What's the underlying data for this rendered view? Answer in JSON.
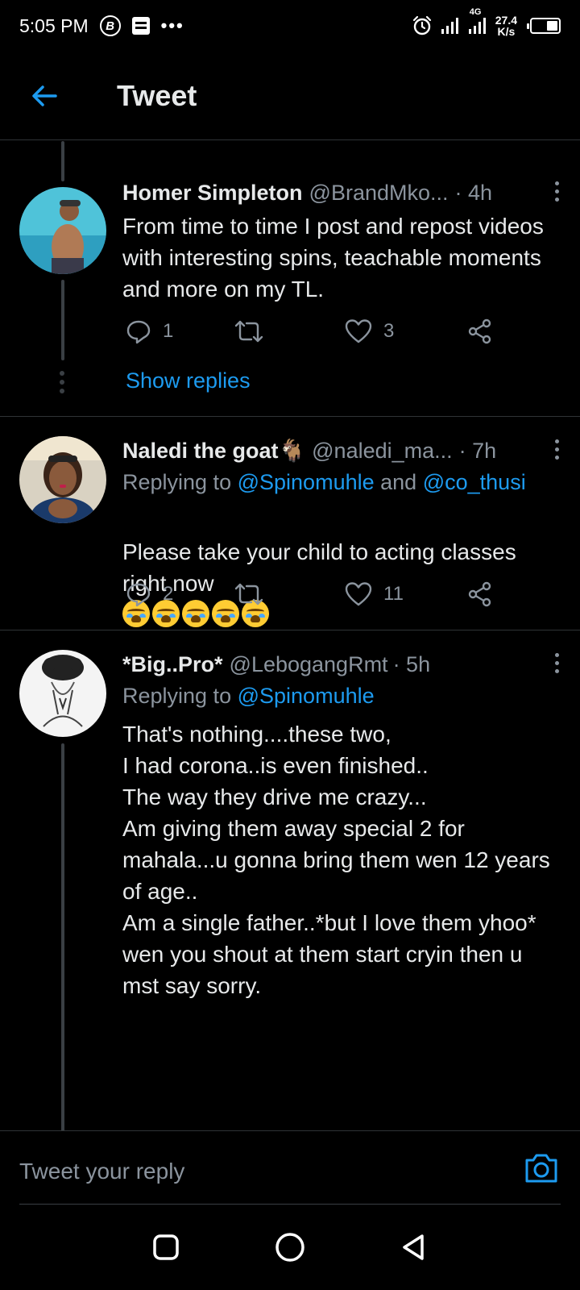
{
  "status_bar": {
    "time": "5:05 PM",
    "badge_letter": "B",
    "more_indicator": "•••",
    "network_label": "4G",
    "speed_value": "27.4",
    "speed_unit": "K/s",
    "battery_level": 0.45
  },
  "header": {
    "title": "Tweet"
  },
  "tweets": [
    {
      "name": "Homer Simpleton",
      "handle": "@BrandMko...",
      "time": "· 4h",
      "text": "From time to time I post and repost videos with interesting spins, teachable moments and more on my TL.",
      "reply_count": "1",
      "retweet_count": "",
      "like_count": "3",
      "show_replies": "Show replies"
    },
    {
      "name": "Naledi the goat🐐",
      "handle": "@naledi_ma...",
      "time": "· 7h",
      "replying_prefix": "Replying to",
      "replying_mention_1": "@Spinomuhle",
      "replying_and": "and",
      "replying_mention_2": "@co_thusi",
      "text": "Please take your child to acting classes right now",
      "emoji": "😭😭😭😭😭",
      "reply_count": "2",
      "retweet_count": "",
      "like_count": "11"
    },
    {
      "name": "*Big..Pro*",
      "handle": "@LebogangRmt",
      "time": "· 5h",
      "replying_prefix": "Replying to",
      "replying_mention_1": "@Spinomuhle",
      "text": "That's nothing....these two,\nI had corona..is even finished..\nThe way they drive me crazy...\nAm giving them away special 2 for mahala...u gonna bring them wen 12 years of age..\nAm a single father..*but I love them yhoo* wen you shout at them start cryin then u mst say sorry."
    }
  ],
  "reply_bar": {
    "placeholder": "Tweet your reply"
  },
  "icons": {
    "back": "arrow-left-icon",
    "reply": "speech-bubble-icon",
    "retweet": "retweet-icon",
    "like": "heart-icon",
    "share": "share-icon",
    "camera": "camera-icon"
  },
  "colors": {
    "accent": "#1d9bf0",
    "background": "#000000",
    "muted_text": "#8b949e"
  }
}
